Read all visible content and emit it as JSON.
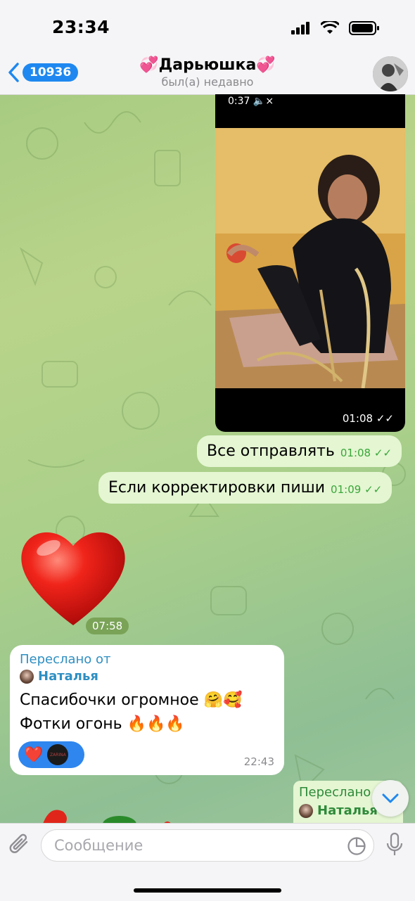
{
  "status_bar": {
    "time": "23:34"
  },
  "header": {
    "back_count": "10936",
    "title": "💞Дарьюшка💞",
    "subtitle": "был(а) недавно"
  },
  "video": {
    "duration": "0:37",
    "time": "01:08"
  },
  "outgoing": [
    {
      "text": "Все отправлять",
      "time": "01:08"
    },
    {
      "text": "Если корректировки пиши",
      "time": "01:09"
    }
  ],
  "sticker": {
    "emoji": "❤",
    "time": "07:58"
  },
  "incoming": {
    "forwarded_label": "Переслано от",
    "forwarded_name": "Наталья",
    "line1": "Спасибочки огромное 🤗🥰",
    "line2": "Фотки огонь 🔥🔥🔥",
    "reaction_emoji": "❤️",
    "reaction_avatar_text": "ZARINA",
    "time": "22:43"
  },
  "partial_forward": {
    "label": "Переслано",
    "name": "Наталья"
  },
  "input": {
    "placeholder": "Сообщение"
  },
  "colors": {
    "accent": "#1e88f0",
    "outgoing_bubble": "#e4f6d2",
    "time_green": "#3aa63a"
  }
}
